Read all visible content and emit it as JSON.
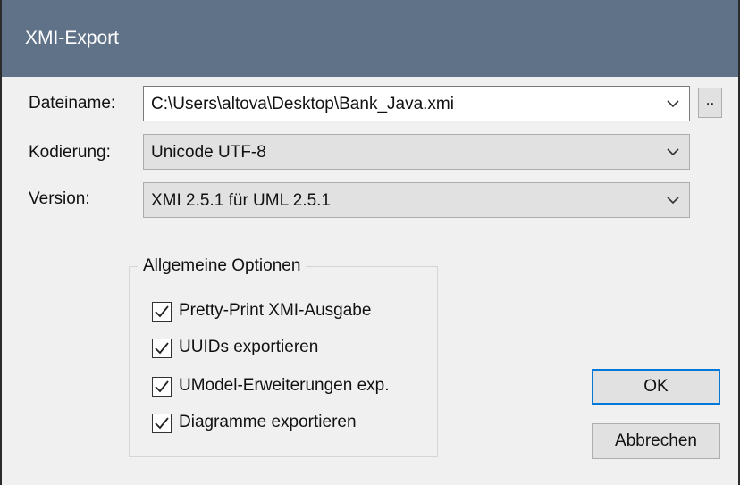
{
  "dialog": {
    "title": "XMI-Export",
    "filename_label": "Dateiname:",
    "filename_value": "C:\\Users\\altova\\Desktop\\Bank_Java.xmi",
    "browse_label": "..",
    "encoding_label": "Kodierung:",
    "encoding_value": "Unicode UTF-8",
    "version_label": "Version:",
    "version_value": "XMI 2.5.1 für UML 2.5.1",
    "options_group": {
      "title": "Allgemeine Optionen",
      "items": [
        {
          "label": "Pretty-Print XMI-Ausgabe",
          "checked": true
        },
        {
          "label": "UUIDs exportieren",
          "checked": true
        },
        {
          "label": "UModel-Erweiterungen exp.",
          "checked": true
        },
        {
          "label": "Diagramme exportieren",
          "checked": true
        }
      ]
    },
    "ok_label": "OK",
    "cancel_label": "Abbrechen"
  },
  "colors": {
    "titlebar": "#5f7288",
    "dialog_bg": "#f0f0f0",
    "accent": "#0078d7"
  },
  "icons": [
    "chevron-down-icon",
    "checkmark-icon"
  ]
}
